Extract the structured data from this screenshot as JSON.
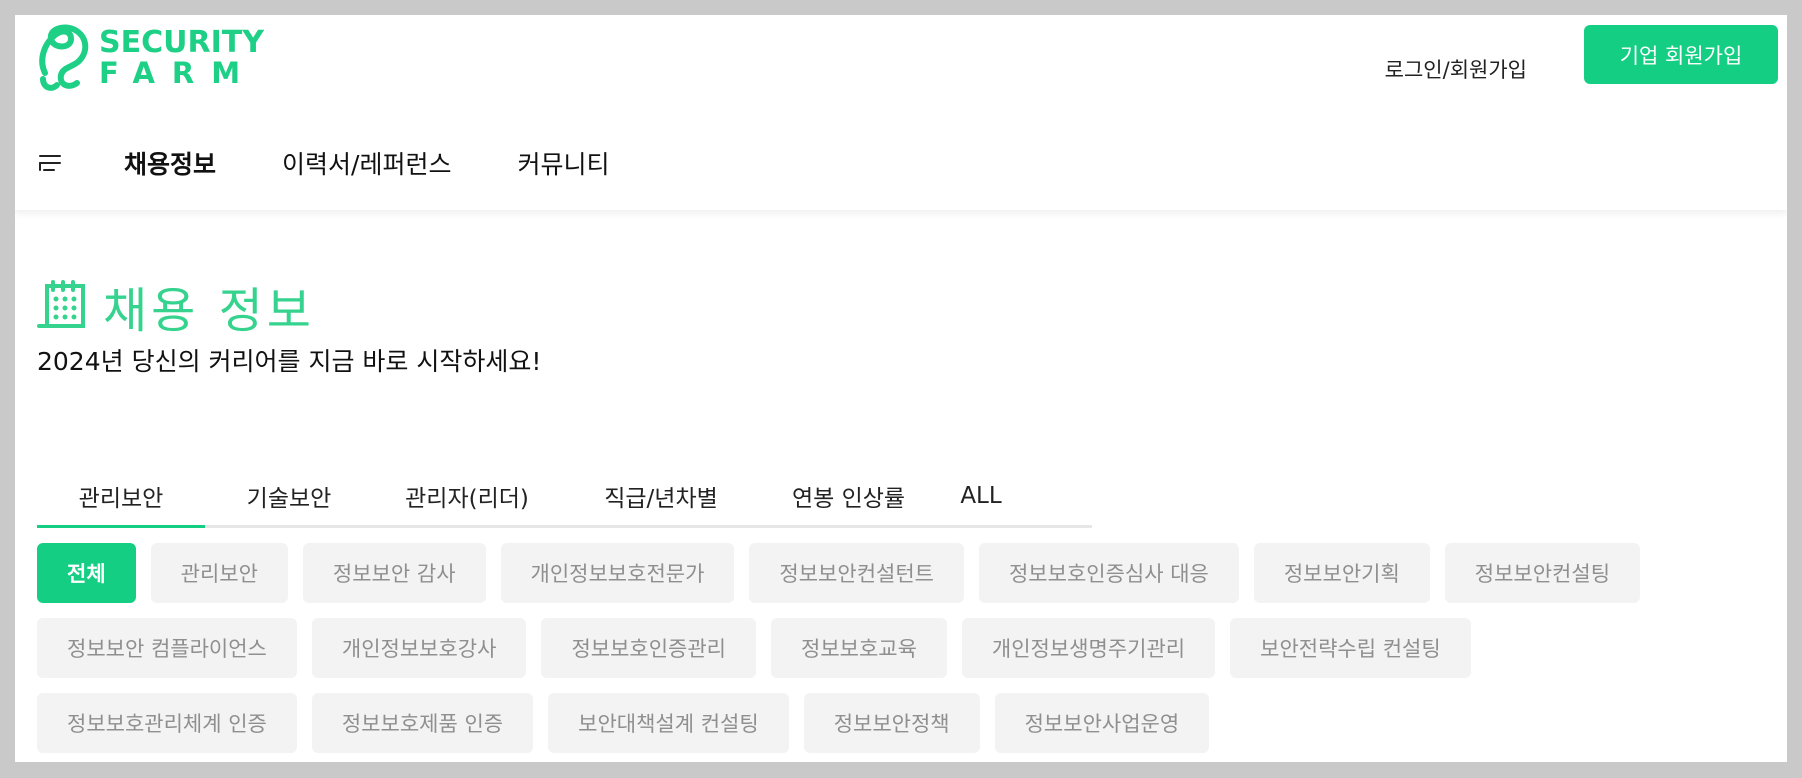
{
  "brand": {
    "line1": "SECURITY",
    "line2": "FARM",
    "color": "#1ecf86"
  },
  "header": {
    "login_label": "로그인/회원가입",
    "corp_signup_label": "기업 회원가입"
  },
  "nav": {
    "menu_icon": "hamburger-menu-icon",
    "items": [
      {
        "label": "채용정보",
        "active": true
      },
      {
        "label": "이력서/레퍼런스",
        "active": false
      },
      {
        "label": "커뮤니티",
        "active": false
      }
    ]
  },
  "page": {
    "title_icon": "calendar-icon",
    "title": "채용 정보",
    "subtitle": "2024년 당신의 커리어를 지금 바로 시작하세요!"
  },
  "tabs": [
    {
      "label": "관리보안",
      "active": true
    },
    {
      "label": "기술보안",
      "active": false
    },
    {
      "label": "관리자(리더)",
      "active": false
    },
    {
      "label": "직급/년차별",
      "active": false
    },
    {
      "label": "연봉 인상률",
      "active": false
    },
    {
      "label": "ALL",
      "active": false
    }
  ],
  "chips": {
    "row1": [
      "전체",
      "관리보안",
      "정보보안 감사",
      "개인정보보호전문가",
      "정보보안컨설턴트",
      "정보보호인증심사 대응",
      "정보보안기획",
      "정보보안컨설팅"
    ],
    "row2": [
      "정보보안 컴플라이언스",
      "개인정보보호강사",
      "정보보호인증관리",
      "정보보호교육",
      "개인정보생명주기관리",
      "보안전략수립 컨설팅"
    ],
    "row3": [
      "정보보호관리체계 인증",
      "정보보호제품 인증",
      "보안대책설계 컨설팅",
      "정보보안정책",
      "정보보안사업운영"
    ],
    "active": "전체"
  },
  "colors": {
    "accent": "#13ce83",
    "chip_bg": "#f3f3f3",
    "chip_text": "#8f8f8f"
  }
}
